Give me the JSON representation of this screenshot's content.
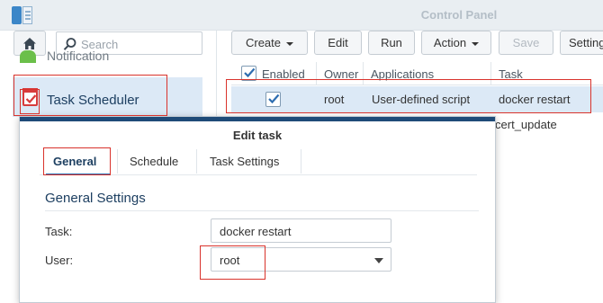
{
  "window": {
    "title": "Control Panel"
  },
  "sidebar": {
    "search_placeholder": "Search",
    "items": [
      {
        "label": "Notification"
      },
      {
        "label": "Task Scheduler"
      }
    ]
  },
  "toolbar": {
    "create_label": "Create",
    "edit_label": "Edit",
    "run_label": "Run",
    "action_label": "Action",
    "save_label": "Save",
    "settings_label": "Settings"
  },
  "table": {
    "columns": [
      "Enabled",
      "Owner",
      "Applications",
      "Task"
    ],
    "rows": [
      {
        "enabled": true,
        "owner": "root",
        "application": "User-defined script",
        "task": "docker restart"
      },
      {
        "enabled": false,
        "owner": "",
        "application": "",
        "task": "acme_cert_update"
      }
    ]
  },
  "dialog": {
    "title": "Edit task",
    "tabs": [
      "General",
      "Schedule",
      "Task Settings"
    ],
    "active_tab": "General",
    "section_title": "General Settings",
    "task_label": "Task:",
    "task_value": "docker restart",
    "user_label": "User:",
    "user_value": "root"
  },
  "colors": {
    "highlight_red": "#d9332c",
    "selection_blue": "#dce9f6",
    "dialog_header": "#1f4b78"
  }
}
